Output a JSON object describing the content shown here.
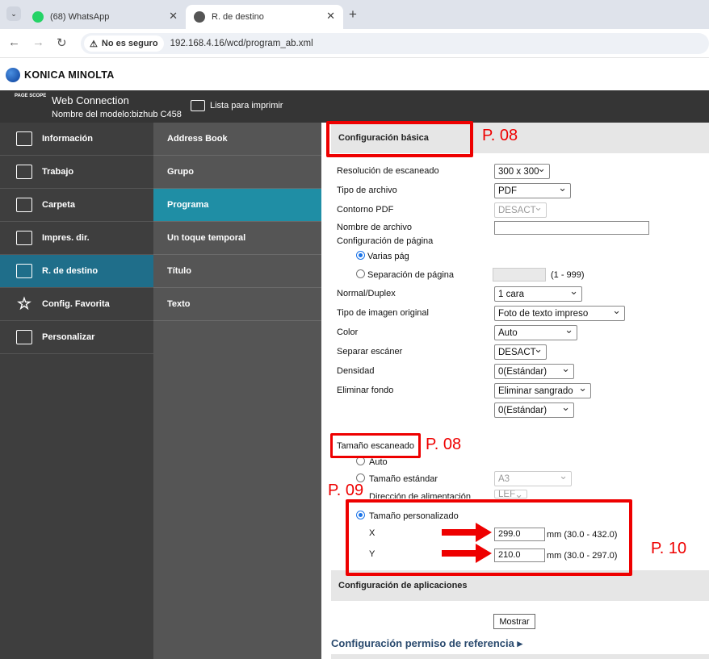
{
  "browser": {
    "tabs": [
      {
        "title": "(68) WhatsApp",
        "active": false
      },
      {
        "title": "R. de destino",
        "active": true
      }
    ],
    "security_label": "No es seguro",
    "url": "192.168.4.16/wcd/program_ab.xml"
  },
  "brand": {
    "name": "KONICA MINOLTA"
  },
  "header": {
    "logo_text": "PAGE SCOPE",
    "app_title": "Web Connection",
    "model": "Nombre del modelo:bizhub C458",
    "print_list": "Lista para imprimir"
  },
  "menu": {
    "items": [
      {
        "label": "Información",
        "icon": "info-printer-icon"
      },
      {
        "label": "Trabajo",
        "icon": "document-icon"
      },
      {
        "label": "Carpeta",
        "icon": "tray-icon"
      },
      {
        "label": "Impres. dir.",
        "icon": "direct-print-icon"
      },
      {
        "label": "R. de destino",
        "icon": "address-book-icon"
      },
      {
        "label": "Config. Favorita",
        "icon": "star-icon"
      },
      {
        "label": "Personalizar",
        "icon": "customize-icon"
      }
    ],
    "active_index": 4
  },
  "submenu": {
    "items": [
      "Address Book",
      "Grupo",
      "Programa",
      "Un toque temporal",
      "Título",
      "Texto"
    ],
    "active_index": 2
  },
  "basic": {
    "title": "Configuración básica",
    "resolution_label": "Resolución de escaneado",
    "resolution_value": "300 x 300",
    "filetype_label": "Tipo de archivo",
    "filetype_value": "PDF",
    "pdf_label": "Contorno PDF",
    "pdf_value": "DESACT",
    "filename_label": "Nombre de archivo",
    "filename_value": "",
    "page_label": "Configuración de página",
    "multi_label": "Varias pág",
    "sep_label": "Separación de página",
    "sep_value": "",
    "sep_range": "(1 - 999)",
    "duplex_label": "Normal/Duplex",
    "duplex_value": "1 cara",
    "original_label": "Tipo de imagen original",
    "original_value": "Foto de texto impreso",
    "color_label": "Color",
    "color_value": "Auto",
    "separate_label": "Separar escáner",
    "separate_value": "DESACT",
    "density_label": "Densidad",
    "density_value": "0(Estándar)",
    "bg_label": "Eliminar fondo",
    "bg_value": "Eliminar sangrado",
    "bg_level_value": "0(Estándar)"
  },
  "scan_size": {
    "title": "Tamaño escaneado",
    "auto_label": "Auto",
    "standard_label": "Tamaño estándar",
    "standard_value": "A3",
    "feed_label": "Dirección de alimentación",
    "feed_value": "LEF",
    "custom_label": "Tamaño personalizado",
    "x_label": "X",
    "x_value": "299.0",
    "x_range": "mm (30.0 - 432.0)",
    "y_label": "Y",
    "y_value": "210.0",
    "y_range": "mm (30.0 - 297.0)"
  },
  "apps": {
    "title": "Configuración de aplicaciones",
    "show_button": "Mostrar"
  },
  "reference": {
    "label": "Configuración permiso de referencia ▸"
  },
  "annotations": {
    "p08a": "P. 08",
    "p08b": "P. 08",
    "p09": "P. 09",
    "p10": "P. 10"
  },
  "colors": {
    "accent": "#1f6e8a",
    "annotation": "#ee0000"
  }
}
